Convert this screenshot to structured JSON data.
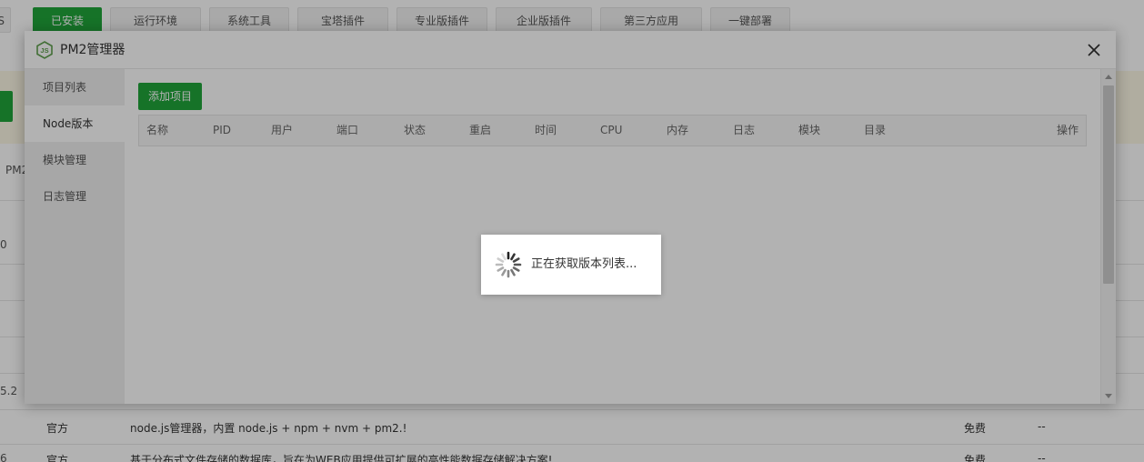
{
  "background": {
    "tabs": [
      {
        "label": "已安装",
        "active": true
      },
      {
        "label": "运行环境",
        "active": false
      },
      {
        "label": "系统工具",
        "active": false
      },
      {
        "label": "宝塔插件",
        "active": false
      },
      {
        "label": "专业版插件",
        "active": false
      },
      {
        "label": "企业版插件",
        "active": false
      },
      {
        "label": "第三方应用",
        "active": false
      },
      {
        "label": "一键部署",
        "active": false
      }
    ],
    "edge_texts": {
      "first_tab_edge": "S",
      "pm2": "PM2",
      "v1": "0",
      "v2": "5.2",
      "v3": "6"
    },
    "rows": [
      {
        "type": "官方",
        "desc": "node.js管理器，内置 node.js + npm + nvm + pm2.!",
        "price": "免费",
        "expire": "--"
      },
      {
        "type": "官方",
        "desc": "基于分布式文件存储的数据库，旨在为WEB应用提供可扩展的高性能数据存储解决方案!",
        "price": "免费",
        "expire": "--"
      }
    ]
  },
  "modal": {
    "title": "PM2管理器",
    "sidebar": [
      {
        "label": "项目列表",
        "active": false
      },
      {
        "label": "Node版本",
        "active": true
      },
      {
        "label": "模块管理",
        "active": false
      },
      {
        "label": "日志管理",
        "active": false
      }
    ],
    "add_button": "添加项目",
    "columns": [
      "名称",
      "PID",
      "用户",
      "端口",
      "状态",
      "重启",
      "时间",
      "CPU",
      "内存",
      "日志",
      "模块",
      "目录",
      "操作"
    ],
    "loading_text": "正在获取版本列表..."
  },
  "colors": {
    "accent": "#20a53a",
    "overlay": "rgba(0,0,0,0.30)"
  }
}
